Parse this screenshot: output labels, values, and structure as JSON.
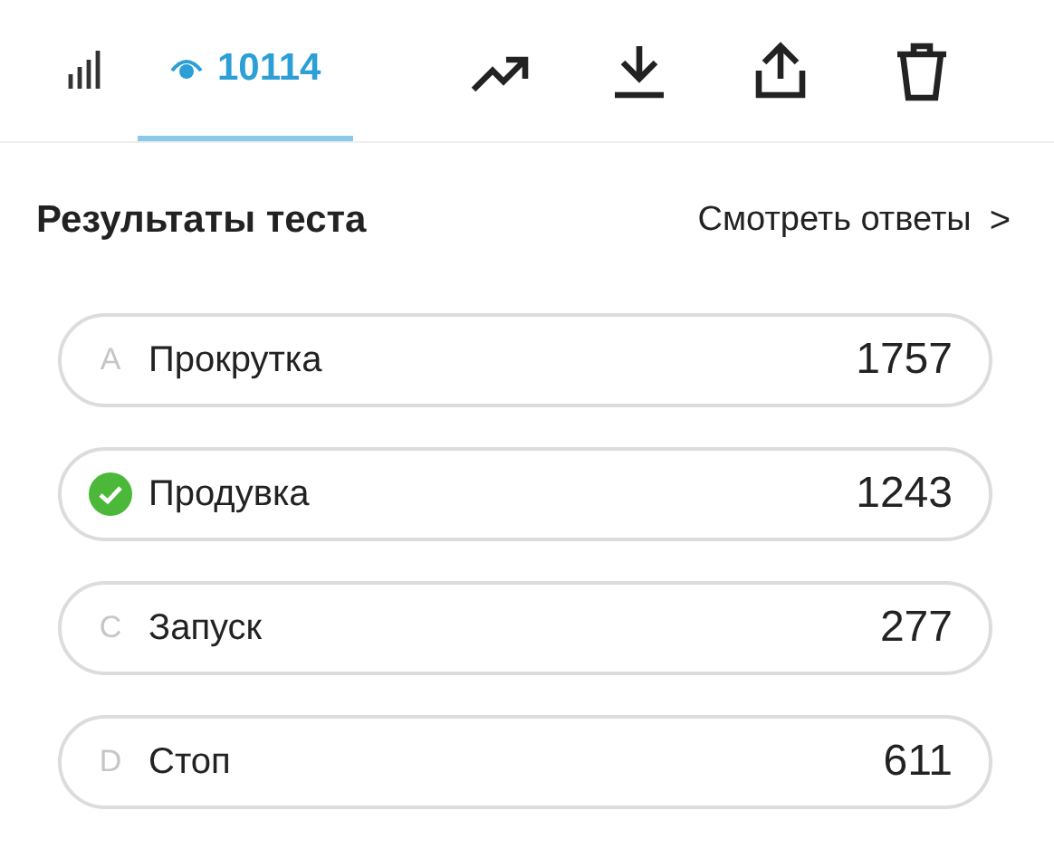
{
  "tabs": [
    {
      "kind": "stats",
      "selected": false
    },
    {
      "kind": "views",
      "label": "10114",
      "selected": true
    }
  ],
  "toolbar": [
    {
      "kind": "trend"
    },
    {
      "kind": "download"
    },
    {
      "kind": "share"
    },
    {
      "kind": "delete"
    }
  ],
  "results": {
    "title": "Результаты теста",
    "link": "Смотреть ответы",
    "link_arrow": ">"
  },
  "options": [
    {
      "letter": "A",
      "text": "Прокрутка",
      "count": "1757",
      "correct": false
    },
    {
      "text": "Продувка",
      "count": "1243",
      "correct": true
    },
    {
      "letter": "C",
      "text": "Запуск",
      "count": "277",
      "correct": false
    },
    {
      "letter": "D",
      "text": "Стоп",
      "count": "611",
      "correct": false
    }
  ]
}
